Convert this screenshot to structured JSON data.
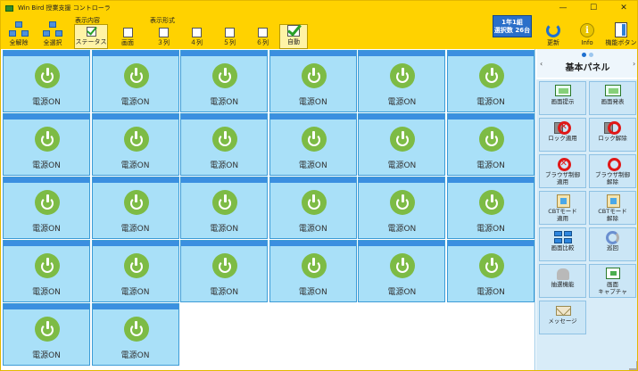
{
  "window": {
    "title": "Win Bird 授業支援 コントローラ"
  },
  "toolbar": {
    "deselect_all": "全解除",
    "select_all": "全選択",
    "content_group": "表示内容",
    "status": "ステータス",
    "screen": "画面",
    "layout_group": "表示形式",
    "col3": "３列",
    "col4": "４列",
    "col5": "５列",
    "col6": "６列",
    "auto": "自動",
    "refresh": "更新",
    "info": "Info",
    "func": "機能ボタン"
  },
  "class_info": {
    "line1": "1年1組",
    "line2": "選択数 26台"
  },
  "tile_label": "電源ON",
  "side_panel": {
    "title": "基本パネル",
    "buttons": [
      "画面提示",
      "画面発表",
      "ロック適用",
      "ロック解除",
      "ブラウザ制御\n適用",
      "ブラウザ制御\n解除",
      "CBTモード\n適用",
      "CBTモード\n解除",
      "画面比較",
      "巡回",
      "抽選機能",
      "画面\nキャプチャ",
      "メッセージ"
    ]
  },
  "colors": {
    "titlebar": "#ffd200",
    "tile": "#a9e0f8",
    "tile_header": "#3b8fe0",
    "power": "#7dbb45"
  }
}
